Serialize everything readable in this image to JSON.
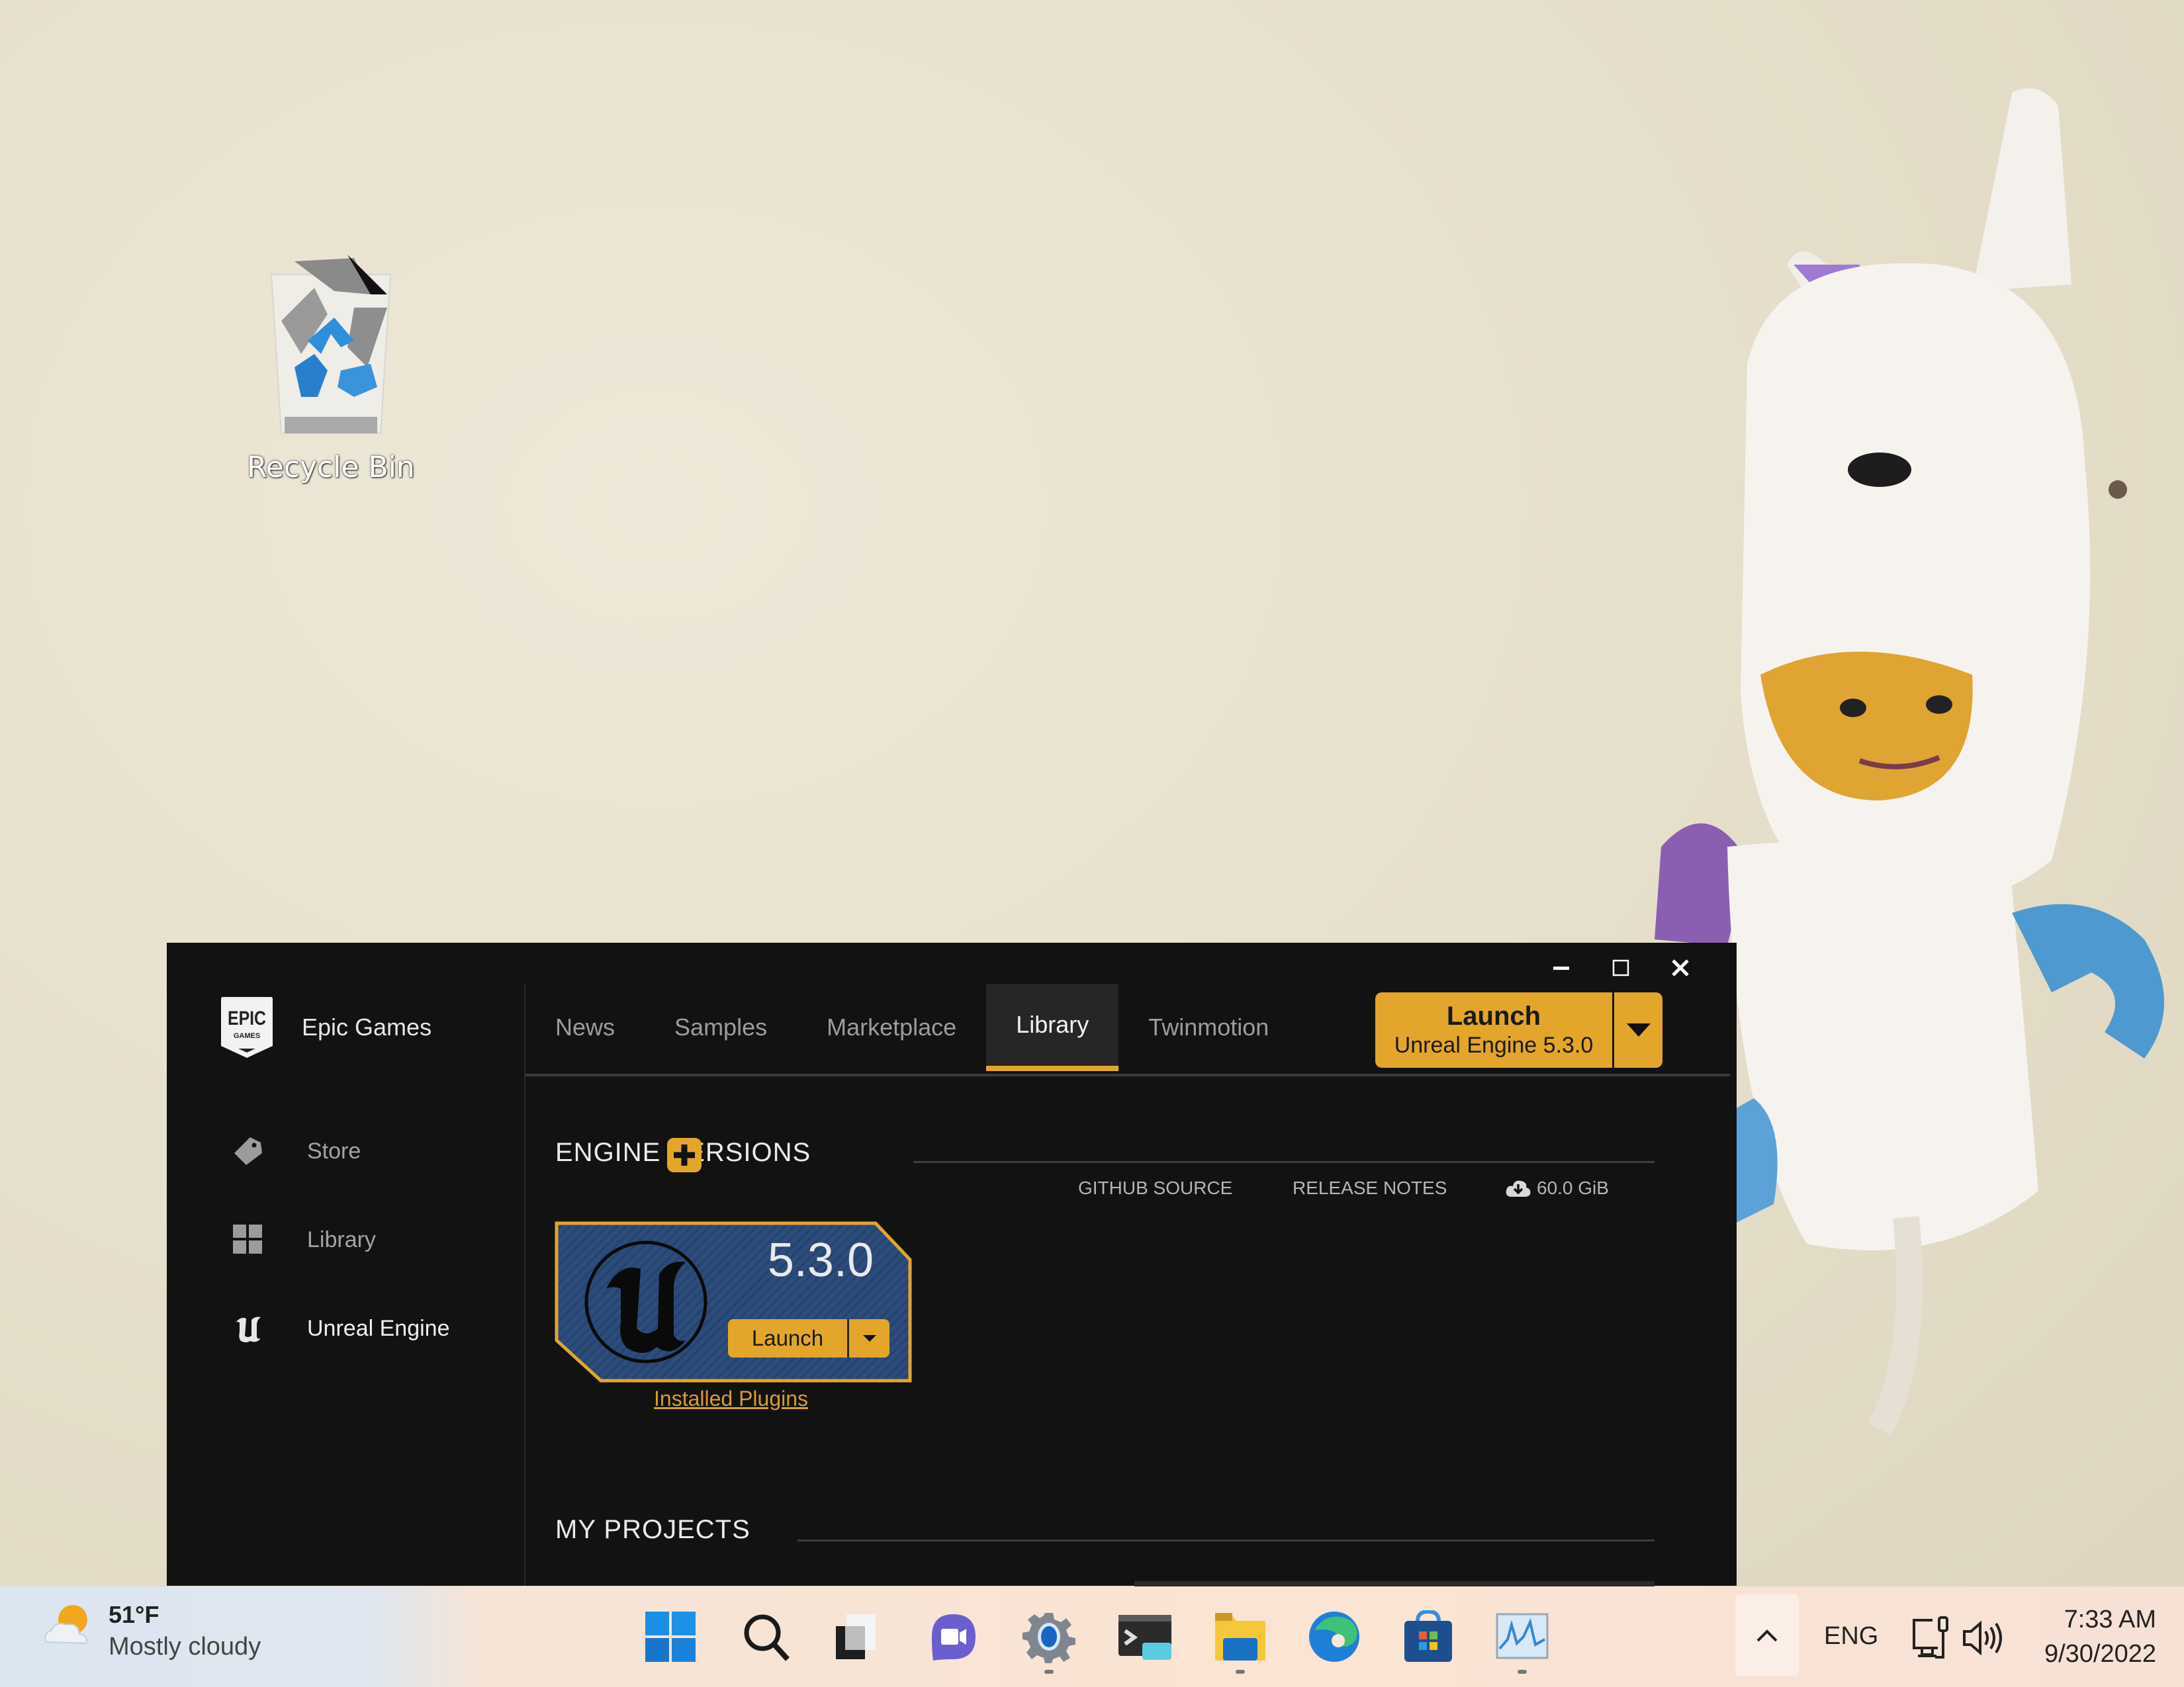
{
  "desktop": {
    "icons": [
      {
        "label": "Recycle Bin",
        "icon": "recycle-bin-icon"
      }
    ],
    "wallpaper": "lego-unicorn-minifigure"
  },
  "window": {
    "controls": {
      "minimize": "minimize-icon",
      "maximize": "maximize-icon",
      "close": "close-icon"
    },
    "brand": {
      "name": "Epic Games",
      "logo_text_top": "EPIC",
      "logo_text_bottom": "GAMES"
    },
    "sidebar": {
      "items": [
        {
          "label": "Store",
          "icon": "tag-icon",
          "active": false
        },
        {
          "label": "Library",
          "icon": "grid-icon",
          "active": false
        },
        {
          "label": "Unreal Engine",
          "icon": "unreal-logo-icon",
          "active": true
        }
      ]
    },
    "tabs": [
      {
        "label": "News",
        "active": false
      },
      {
        "label": "Samples",
        "active": false
      },
      {
        "label": "Marketplace",
        "active": false
      },
      {
        "label": "Library",
        "active": true
      },
      {
        "label": "Twinmotion",
        "active": false
      }
    ],
    "launch_button": {
      "label": "Launch",
      "sublabel": "Unreal Engine 5.3.0"
    },
    "engine_versions": {
      "title": "ENGINE VERSIONS",
      "links": {
        "github": "GITHUB SOURCE",
        "release_notes": "RELEASE NOTES",
        "size": "60.0 GiB"
      },
      "card": {
        "version": "5.3.0",
        "launch_label": "Launch",
        "plugins_link": "Installed Plugins"
      }
    },
    "my_projects": {
      "title": "MY PROJECTS"
    }
  },
  "colors": {
    "accent": "#e3a62a",
    "window_bg": "#121212",
    "card_bg": "#2b4a78"
  },
  "taskbar": {
    "weather": {
      "temp": "51°F",
      "condition": "Mostly cloudy"
    },
    "apps": [
      {
        "name": "start"
      },
      {
        "name": "search"
      },
      {
        "name": "task-view"
      },
      {
        "name": "teams-chat"
      },
      {
        "name": "settings",
        "running": true
      },
      {
        "name": "terminal"
      },
      {
        "name": "file-explorer",
        "running": true
      },
      {
        "name": "edge"
      },
      {
        "name": "store"
      },
      {
        "name": "performance-monitor",
        "running": true
      }
    ],
    "tray": {
      "language": "ENG",
      "time": "7:33 AM",
      "date": "9/30/2022"
    }
  }
}
